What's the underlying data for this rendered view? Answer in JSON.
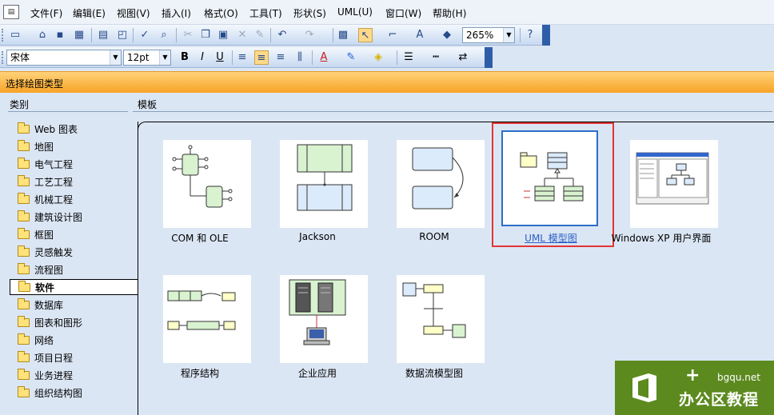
{
  "menu": {
    "app_icon": "doc-icon",
    "items": [
      "文件(F)",
      "编辑(E)",
      "视图(V)",
      "插入(I)",
      "格式(O)",
      "工具(T)",
      "形状(S)",
      "UML(U)",
      "窗口(W)",
      "帮助(H)"
    ]
  },
  "toolbar1": {
    "zoom": "265%"
  },
  "toolbar2": {
    "font": "宋体",
    "size": "12pt",
    "bold": "B",
    "italic": "I",
    "underline": "U",
    "font_color_letter": "A"
  },
  "panel": {
    "title": "选择绘图类型"
  },
  "categories": {
    "header": "类别",
    "items": [
      "Web 图表",
      "地图",
      "电气工程",
      "工艺工程",
      "机械工程",
      "建筑设计图",
      "框图",
      "灵感触发",
      "流程图",
      "软件",
      "数据库",
      "图表和图形",
      "网络",
      "项目日程",
      "业务进程",
      "组织结构图"
    ],
    "selected": "软件"
  },
  "templates": {
    "header": "模板",
    "items": [
      "COM 和 OLE",
      "Jackson",
      "ROOM",
      "UML 模型图",
      "Windows XP 用户界面",
      "程序结构",
      "企业应用",
      "数据流模型图"
    ],
    "selected": "UML 模型图"
  },
  "watermark": {
    "url": "bgqu.net",
    "name": "办公区教程"
  },
  "colors": {
    "accent_orange": "#f7a325",
    "highlight_red": "#e33535",
    "watermark_green": "#5c8a1f"
  }
}
